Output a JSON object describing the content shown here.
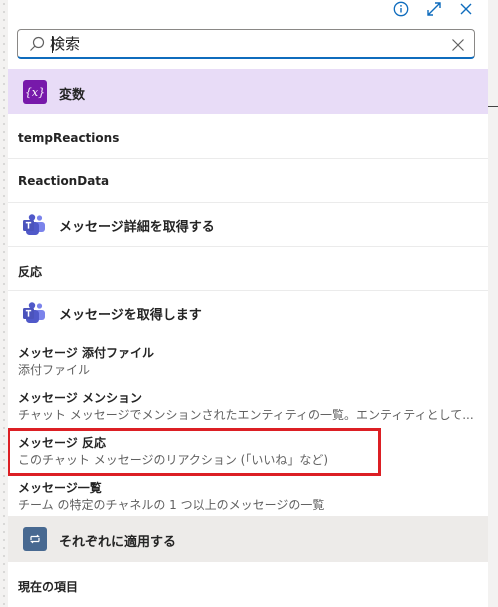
{
  "search": {
    "placeholder": "検索",
    "value": ""
  },
  "sections": {
    "variables": {
      "label": "変数",
      "icon": "variable-icon",
      "color": "#7719aa"
    },
    "apply_each": {
      "label": "それぞれに適用する",
      "icon": "loop-icon"
    }
  },
  "items": [
    {
      "label": "tempReactions"
    },
    {
      "label": "ReactionData"
    },
    {
      "label": "メッセージ詳細を取得する",
      "icon": "teams-icon"
    },
    {
      "label": "反応"
    },
    {
      "label": "メッセージを取得します",
      "icon": "teams-icon"
    },
    {
      "label": "メッセージ 添付ファイル",
      "desc": "添付ファイル"
    },
    {
      "label": "メッセージ メンション",
      "desc": "チャット メッセージでメンションされたエンティティの一覧。エンティティとして..."
    },
    {
      "label": "メッセージ 反応",
      "desc": "このチャット メッセージのリアクション (「いいね」など)",
      "highlighted": true
    },
    {
      "label": "メッセージ一覧",
      "desc": "チーム の特定のチャネルの 1 つ以上のメッセージの一覧"
    },
    {
      "label": "現在の項目"
    }
  ],
  "colors": {
    "accent": "#0f6cbd",
    "highlight": "#dc1f24",
    "variables_bg": "#e8dcf7",
    "apply_bg": "#edebe9"
  }
}
